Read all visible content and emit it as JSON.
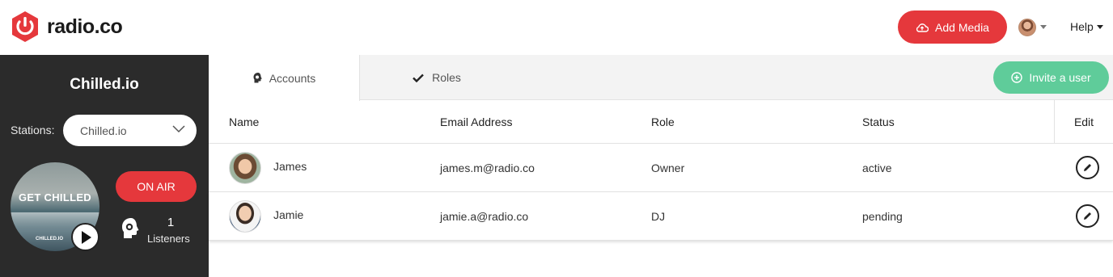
{
  "app": {
    "logo_text": "radio.co",
    "add_media_label": "Add Media",
    "help_label": "Help",
    "colors": {
      "accent_red": "#e5383c",
      "accent_green": "#5fcc9a",
      "sidebar_bg": "#2b2b2b"
    }
  },
  "sidebar": {
    "station_title": "Chilled.io",
    "stations_label": "Stations:",
    "selected_station": "Chilled.io",
    "artwork_title": "GET CHILLED",
    "artwork_caption": "CHILLED.IO",
    "on_air_label": "ON AIR",
    "listeners_count": "1",
    "listeners_label": "Listeners"
  },
  "tabs": {
    "accounts_label": "Accounts",
    "roles_label": "Roles",
    "invite_label": "Invite a user"
  },
  "table": {
    "columns": [
      "Name",
      "Email Address",
      "Role",
      "Status",
      "Edit"
    ],
    "rows": [
      {
        "name": "James",
        "email": "james.m@radio.co",
        "role": "Owner",
        "status": "active"
      },
      {
        "name": "Jamie",
        "email": "jamie.a@radio.co",
        "role": "DJ",
        "status": "pending"
      }
    ]
  }
}
